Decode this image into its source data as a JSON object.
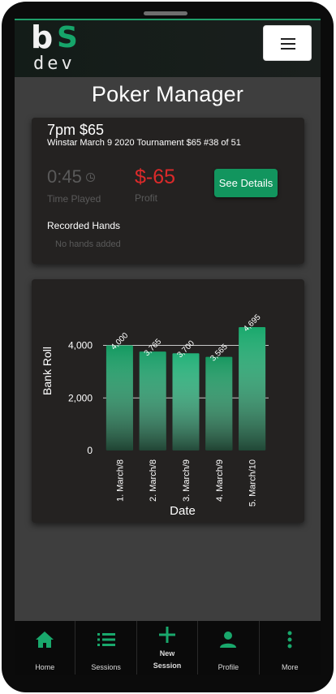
{
  "header": {
    "logo_b": "b",
    "logo_s": "S",
    "logo_dev": "dev"
  },
  "page_title": "Poker Manager",
  "session": {
    "title": "7pm $65",
    "subtitle": "Winstar March 9 2020 Tournament $65 #38 of 51",
    "time_value": "0:45",
    "time_label": "Time Played",
    "profit_value": "$-65",
    "profit_label": "Profit",
    "details_button": "See Details",
    "hands_title": "Recorded Hands",
    "hands_empty": "No hands added"
  },
  "chart_data": {
    "type": "bar",
    "categories": [
      "1. March/8",
      "2. March/8",
      "3. March/9",
      "4. March/9",
      "5. March/10"
    ],
    "values": [
      4000,
      3765,
      3700,
      3565,
      4695
    ],
    "value_labels": [
      "4,000",
      "3,765",
      "3,700",
      "3,565",
      "4,695"
    ],
    "y_ticks": [
      "0",
      "2,000",
      "4,000"
    ],
    "y_tick_values": [
      0,
      2000,
      4000
    ],
    "xlabel": "Date",
    "ylabel": "Bank Roll",
    "ylim": [
      0,
      4695
    ],
    "grid": true,
    "bar_colors": [
      "#139960",
      "#1a9e68",
      "#22b077",
      "#17975f",
      "#19a86c"
    ]
  },
  "colors": {
    "accent": "#12955e",
    "loss": "#dc2a2a",
    "card": "#242221",
    "background": "#3e3e3e"
  },
  "nav": {
    "items": [
      {
        "label": "Home",
        "icon": "home-icon"
      },
      {
        "label": "Sessions",
        "icon": "list-icon"
      },
      {
        "label": "New Session",
        "label_line1": "New",
        "label_line2": "Session",
        "icon": "plus-icon"
      },
      {
        "label": "Profile",
        "icon": "person-icon"
      },
      {
        "label": "More",
        "icon": "more-vertical-icon"
      }
    ]
  }
}
